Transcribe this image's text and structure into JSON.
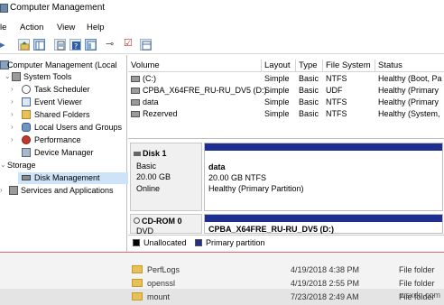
{
  "window": {
    "title": "Computer Management"
  },
  "menu": [
    "le",
    "Action",
    "View",
    "Help"
  ],
  "toolbar": {
    "buttons": [
      "back-arrow",
      "forward-arrow",
      "up-folder",
      "show-hide-tree",
      "help",
      "properties",
      "connect",
      "check",
      "details"
    ]
  },
  "tree": {
    "root": "Computer Management (Local",
    "items": [
      {
        "label": "System Tools",
        "icon": "tools-icon"
      },
      {
        "label": "Task Scheduler",
        "icon": "clock-icon"
      },
      {
        "label": "Event Viewer",
        "icon": "log-icon"
      },
      {
        "label": "Shared Folders",
        "icon": "folder-icon"
      },
      {
        "label": "Local Users and Groups",
        "icon": "users-icon"
      },
      {
        "label": "Performance",
        "icon": "performance-icon"
      },
      {
        "label": "Device Manager",
        "icon": "device-icon"
      },
      {
        "label": "Storage",
        "icon": "storage-icon"
      },
      {
        "label": "Disk Management",
        "icon": "disk-icon"
      },
      {
        "label": "Services and Applications",
        "icon": "services-icon"
      }
    ]
  },
  "volumes": {
    "columns": [
      "Volume",
      "Layout",
      "Type",
      "File System",
      "Status"
    ],
    "rows": [
      [
        "(C:)",
        "Simple",
        "Basic",
        "NTFS",
        "Healthy (Boot, Pa"
      ],
      [
        "CPBA_X64FRE_RU-RU_DV5 (D:)",
        "Simple",
        "Basic",
        "UDF",
        "Healthy (Primary"
      ],
      [
        "data",
        "Simple",
        "Basic",
        "NTFS",
        "Healthy (Primary"
      ],
      [
        "Rezerved",
        "Simple",
        "Basic",
        "NTFS",
        "Healthy (System,"
      ]
    ]
  },
  "disks": [
    {
      "name": "Disk 1",
      "type": "Basic",
      "size": "20.00 GB",
      "state": "Online",
      "partition": {
        "name": "data",
        "detail": "20.00 GB NTFS",
        "status": "Healthy (Primary Partition)"
      }
    },
    {
      "name": "CD-ROM 0",
      "type": "DVD",
      "partition": {
        "name": "CPBA_X64FRE_RU-RU_DV5 (D:)"
      }
    }
  ],
  "legend": [
    {
      "label": "Unallocated",
      "color": "#000000"
    },
    {
      "label": "Primary partition",
      "color": "#1f2f8f"
    }
  ],
  "explorer_rows": [
    {
      "name": "PerfLogs",
      "date": "4/19/2018 4:38 PM",
      "type": "File folder"
    },
    {
      "name": "openssl",
      "date": "4/19/2018 2:55 PM",
      "type": "File folder"
    },
    {
      "name": "mount",
      "date": "7/23/2018 2:49 AM",
      "type": "File folder"
    }
  ],
  "watermark": "wsxdn.com",
  "colors": {
    "primary_partition": "#1f2f8f",
    "selection": "#cde3f7"
  }
}
